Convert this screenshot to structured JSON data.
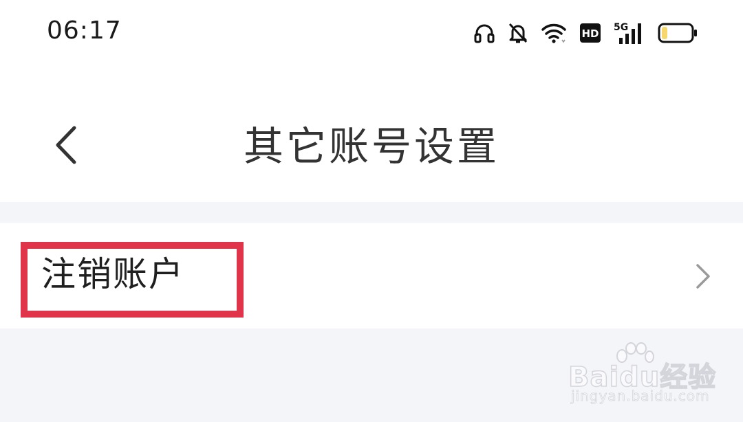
{
  "status_bar": {
    "time": "06:17",
    "icons": [
      "headset-icon",
      "bell-muted-icon",
      "wifi-icon",
      "hd-icon",
      "signal-5g-icon",
      "battery-icon"
    ],
    "hd_label": "HD",
    "network_label": "5G",
    "battery_level": 0.2
  },
  "header": {
    "title": "其它账号设置",
    "back_icon": "chevron-left-icon"
  },
  "settings_list": {
    "items": [
      {
        "label": "注销账户",
        "icon": "chevron-right-icon"
      }
    ]
  },
  "watermark": {
    "main": "Baidu经验",
    "sub": "jingyan.baidu.com"
  },
  "colors": {
    "highlight": "#e0344a",
    "background": "#f4f5f9",
    "surface": "#ffffff",
    "title_text": "#333333"
  }
}
